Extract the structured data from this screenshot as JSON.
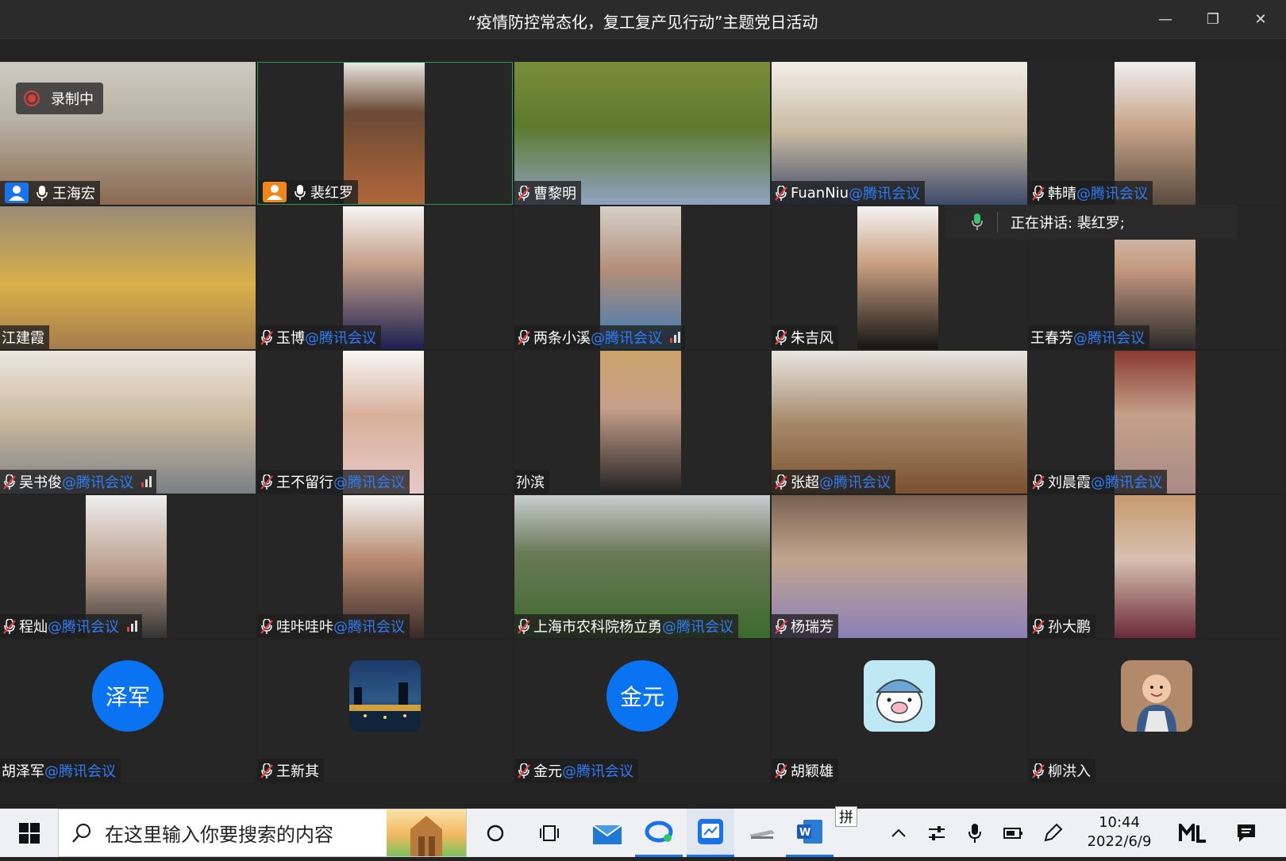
{
  "window": {
    "title": "“疫情防控常态化，复工复产见行动”主题党日活动",
    "controls": {
      "minimize": "—",
      "maximize": "❐",
      "close": "✕"
    }
  },
  "recording": {
    "label": "录制中"
  },
  "speaking": {
    "label": "正在讲话: 裴红罗;"
  },
  "org_suffix": "@腾讯会议",
  "participants": [
    {
      "name": "王海宏",
      "org": "",
      "mic": "on",
      "host": true
    },
    {
      "name": "裴红罗",
      "org": "",
      "mic": "on",
      "host": true,
      "active": true
    },
    {
      "name": "曹黎明",
      "org": "",
      "mic": "muted"
    },
    {
      "name": "FuanNiu",
      "org": "@腾讯会议",
      "mic": "muted"
    },
    {
      "name": "韩晴",
      "org": "@腾讯会议",
      "mic": "muted"
    },
    {
      "name": "江建霞",
      "org": "",
      "mic": "none"
    },
    {
      "name": "玉博",
      "org": "@腾讯会议",
      "mic": "muted"
    },
    {
      "name": "两条小溪",
      "org": "@腾讯会议",
      "mic": "muted",
      "signal": true
    },
    {
      "name": "朱吉风",
      "org": "",
      "mic": "muted"
    },
    {
      "name": "王春芳",
      "org": "@腾讯会议",
      "mic": "none"
    },
    {
      "name": "吴书俊",
      "org": "@腾讯会议",
      "mic": "muted",
      "signal": true
    },
    {
      "name": "王不留行",
      "org": "@腾讯会议",
      "mic": "muted"
    },
    {
      "name": "孙滨",
      "org": "",
      "mic": "none"
    },
    {
      "name": "张超",
      "org": "@腾讯会议",
      "mic": "muted"
    },
    {
      "name": "刘晨霞",
      "org": "@腾讯会议",
      "mic": "muted"
    },
    {
      "name": "程灿",
      "org": "@腾讯会议",
      "mic": "muted",
      "signal": true
    },
    {
      "name": "哇咔哇咔",
      "org": "@腾讯会议",
      "mic": "muted"
    },
    {
      "name": "上海市农科院杨立勇",
      "org": "@腾讯会议",
      "mic": "muted"
    },
    {
      "name": "杨瑞芳",
      "org": "",
      "mic": "muted"
    },
    {
      "name": "孙大鹏",
      "org": "",
      "mic": "muted"
    },
    {
      "name": "胡泽军",
      "org": "@腾讯会议",
      "mic": "none",
      "avatar_text": "泽军"
    },
    {
      "name": "王新其",
      "org": "",
      "mic": "muted",
      "avatar_image": "night-city-photo"
    },
    {
      "name": "金元",
      "org": "@腾讯会议",
      "mic": "muted",
      "avatar_text": "金元"
    },
    {
      "name": "胡颖雄",
      "org": "",
      "mic": "muted",
      "avatar_image": "cartoon-pig"
    },
    {
      "name": "柳洪入",
      "org": "",
      "mic": "muted",
      "avatar_image": "baby-photo"
    }
  ],
  "taskbar": {
    "search_placeholder": "在这里输入你要搜索的内容",
    "ime": "拼",
    "time": "10:44",
    "date": "2022/6/9"
  },
  "colors": {
    "accent": "#2f7df6",
    "avatar_blue": "#0a73f2",
    "active_border": "#2a9d5c",
    "recording_red": "#e03c3c"
  }
}
